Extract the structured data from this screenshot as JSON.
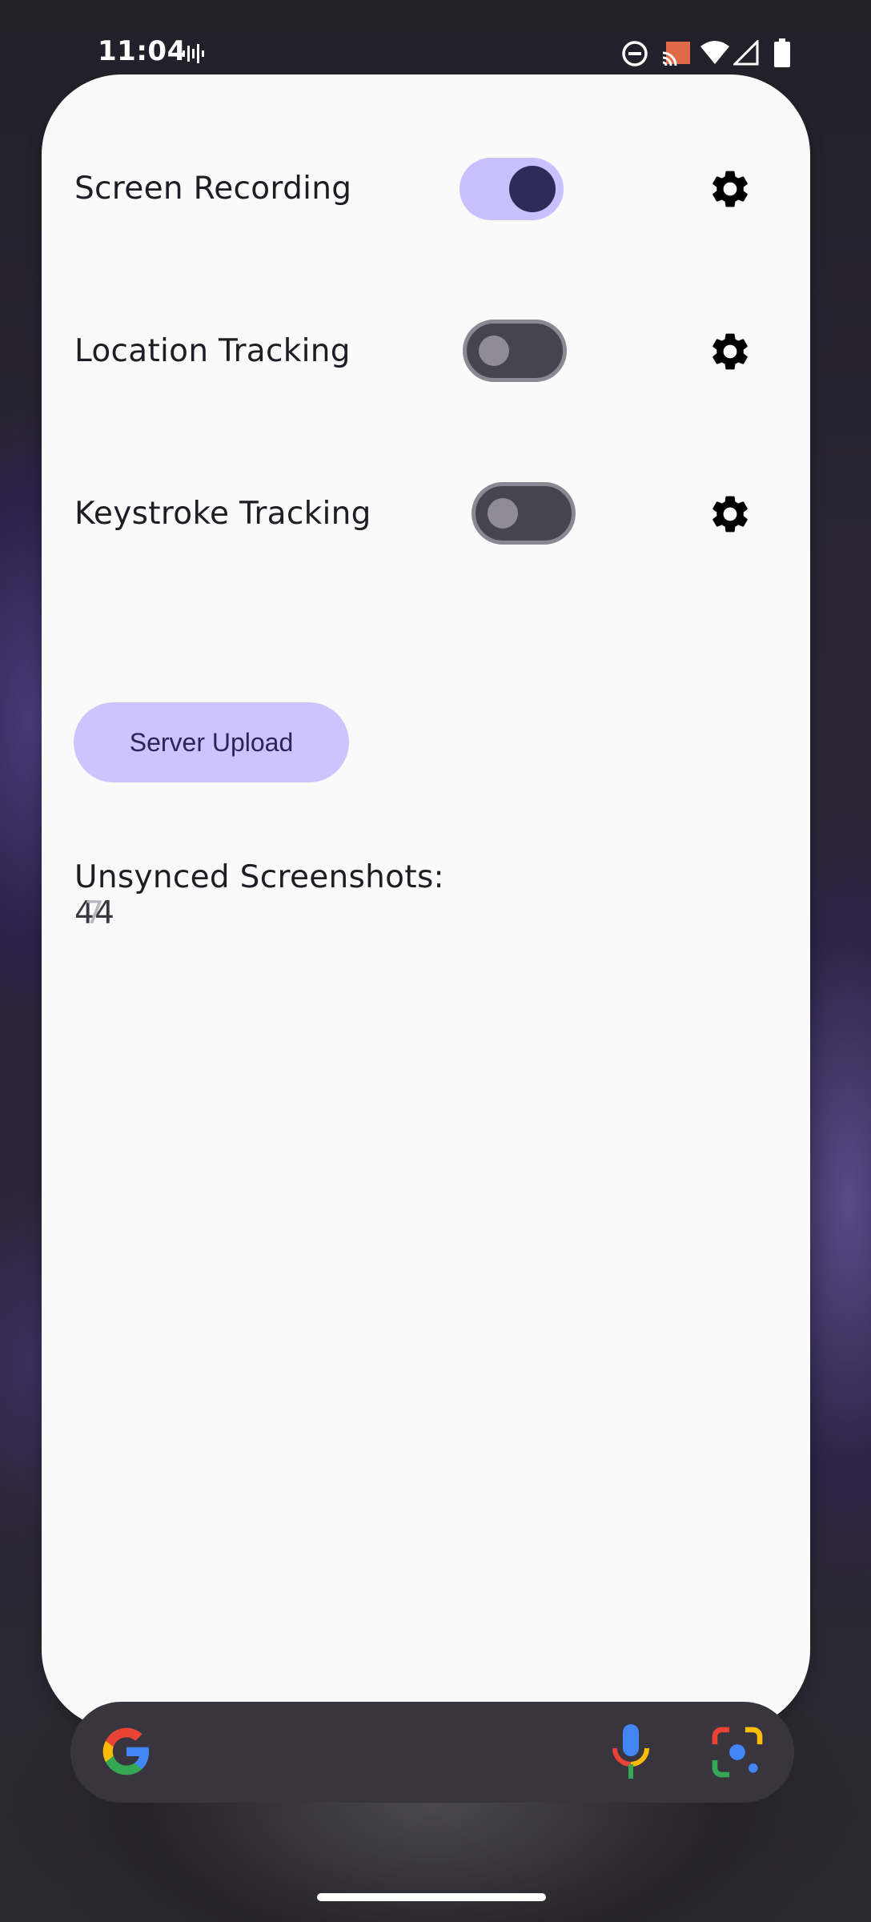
{
  "status_bar": {
    "time": "11:04",
    "icons": [
      "voicemail-wave-icon",
      "do-not-disturb-icon",
      "cast-icon",
      "wifi-icon",
      "signal-icon",
      "battery-icon"
    ]
  },
  "settings": [
    {
      "label": "Screen Recording",
      "toggle_on": true
    },
    {
      "label": "Location Tracking",
      "toggle_on": false
    },
    {
      "label": "Keystroke Tracking",
      "toggle_on": false
    }
  ],
  "upload_button": {
    "label": "Server Upload"
  },
  "unsynced": {
    "label": "Unsynced Screenshots:",
    "count": "44",
    "count_ghost": "7"
  },
  "search_bar": {
    "icons": [
      "google-g-icon",
      "microphone-icon",
      "google-lens-icon"
    ]
  },
  "colors": {
    "accent": "#c9c0ff",
    "accent_dark": "#2f2a57",
    "card_bg": "#fafafb",
    "search_bg": "#38353f"
  }
}
